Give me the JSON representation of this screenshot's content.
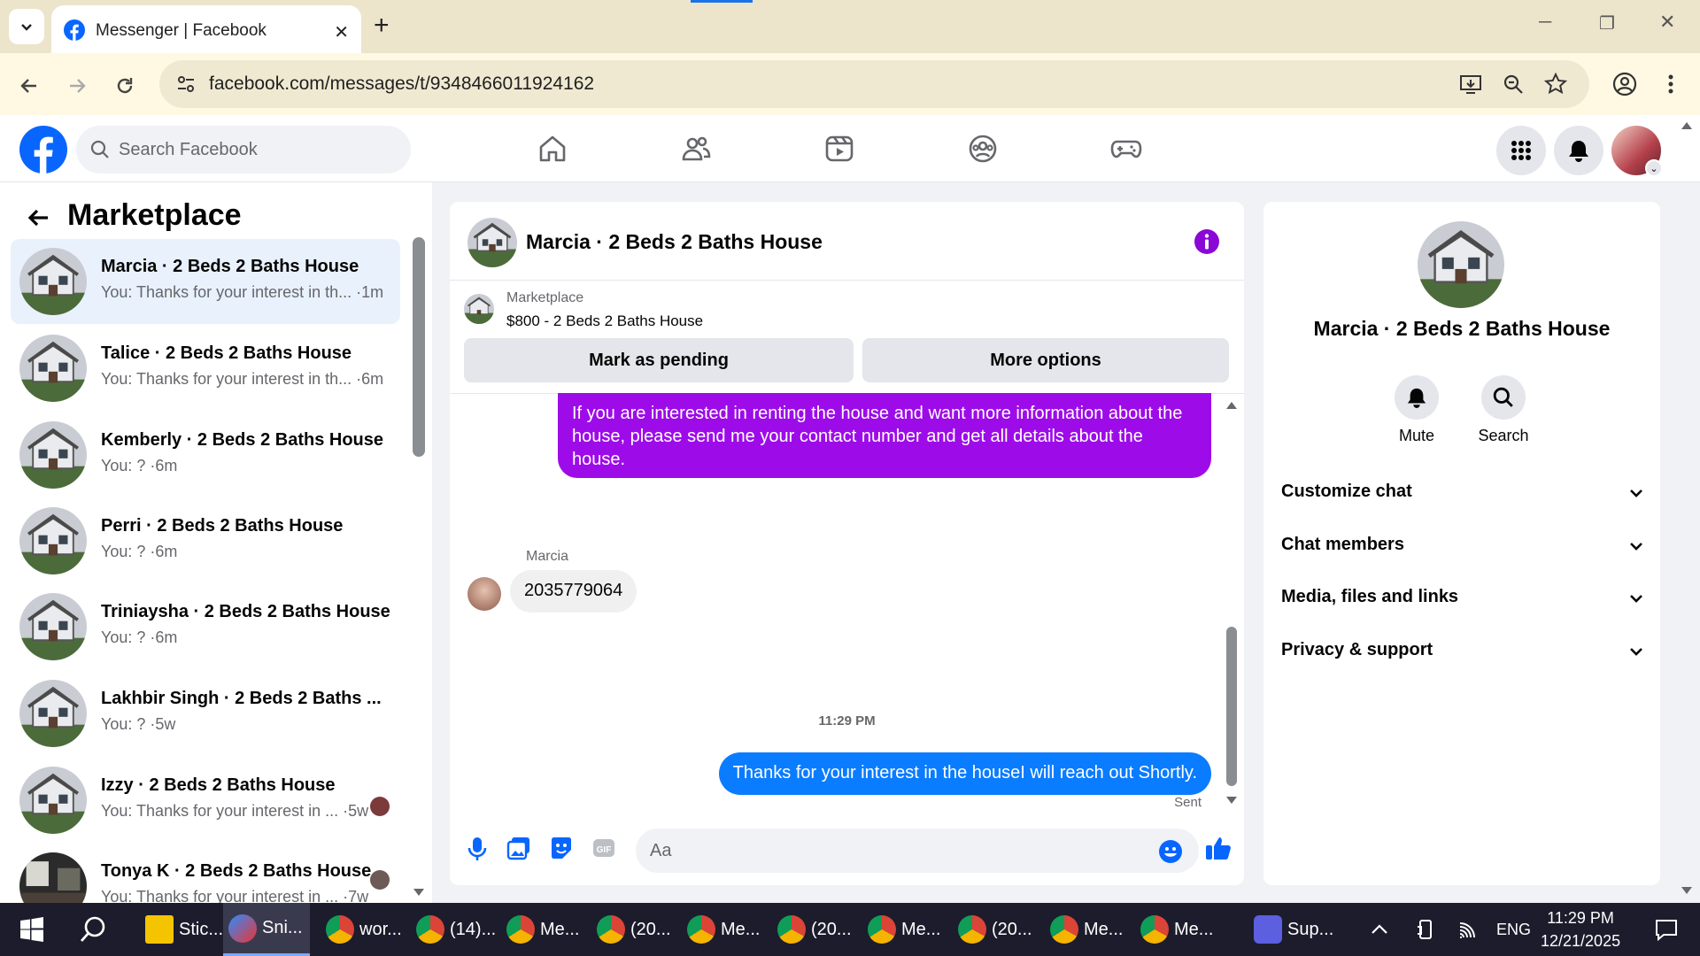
{
  "browser": {
    "tab_title": "Messenger | Facebook",
    "url": "facebook.com/messages/t/9348466011924162"
  },
  "fb": {
    "search_placeholder": "Search Facebook"
  },
  "sidebar": {
    "title": "Marketplace",
    "conversations": [
      {
        "name": "Marcia · 2 Beds 2 Baths House",
        "preview": "You: Thanks for your interest in th... ·1m",
        "active": true
      },
      {
        "name": "Talice · 2 Beds 2 Baths House",
        "preview": "You: Thanks for your interest in th... ·6m"
      },
      {
        "name": "Kemberly · 2 Beds 2 Baths House",
        "preview": "You: ? ·6m"
      },
      {
        "name": "Perri · 2 Beds 2 Baths House",
        "preview": "You: ? ·6m"
      },
      {
        "name": "Triniaysha · 2 Beds 2 Baths House",
        "preview": "You: ? ·6m"
      },
      {
        "name": "Lakhbir Singh · 2 Beds 2 Baths ...",
        "preview": "You: ? ·5w"
      },
      {
        "name": "Izzy · 2 Beds 2 Baths House",
        "preview": "You: Thanks for your interest in ... ·5w"
      },
      {
        "name": "Tonya K · 2 Beds 2 Baths House",
        "preview": "You: Thanks for your interest in ... ·7w"
      }
    ]
  },
  "chat": {
    "title": "Marcia · 2 Beds 2 Baths House",
    "marketplace_label": "Marketplace",
    "listing": "$800 - 2 Beds 2 Baths House",
    "mark_pending": "Mark as pending",
    "more_options": "More options",
    "outgoing_1": "If you are interested in renting the house and want more information about the house, please send me your contact number and get all details about the house.",
    "sender_name": "Marcia",
    "incoming_1": "2035779064",
    "timestamp": "11:29 PM",
    "outgoing_2": "Thanks for your interest in the houseI will reach out Shortly.",
    "status": "Sent",
    "composer_placeholder": "Aa"
  },
  "info_panel": {
    "name": "Marcia · 2 Beds 2 Baths House",
    "mute": "Mute",
    "search": "Search",
    "rows": [
      "Customize chat",
      "Chat members",
      "Media, files and links",
      "Privacy & support"
    ]
  },
  "taskbar": {
    "items": [
      "Stic...",
      "Sni...",
      "wor...",
      "(14)...",
      "Me...",
      "(20...",
      "Me...",
      "(20...",
      "Me...",
      "(20...",
      "Me...",
      "Me...",
      "Sup..."
    ],
    "lang": "ENG",
    "time": "11:29 PM",
    "date": "12/21/2025"
  },
  "colors": {
    "fb_blue": "#0866ff",
    "outgoing_purple": "#9d0ce8",
    "outgoing_blue": "#0a7cff",
    "accent_purple": "#8a07d6"
  }
}
